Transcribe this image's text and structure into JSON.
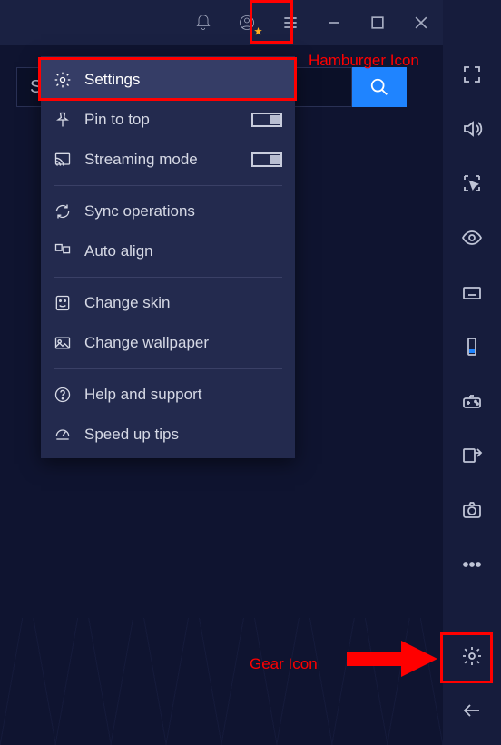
{
  "titlebar": {
    "icons": [
      "bell",
      "user",
      "hamburger",
      "minimize",
      "maximize",
      "close"
    ]
  },
  "search": {
    "value": "S"
  },
  "menu": {
    "items": [
      {
        "icon": "gear",
        "label": "Settings",
        "selected": true
      },
      {
        "icon": "pin",
        "label": "Pin to top",
        "toggle": "off"
      },
      {
        "icon": "cast",
        "label": "Streaming mode",
        "toggle": "off"
      },
      {
        "sep": true
      },
      {
        "icon": "sync",
        "label": "Sync operations"
      },
      {
        "icon": "align",
        "label": "Auto align"
      },
      {
        "sep": true
      },
      {
        "icon": "skin",
        "label": "Change skin"
      },
      {
        "icon": "image",
        "label": "Change wallpaper"
      },
      {
        "sep": true
      },
      {
        "icon": "help",
        "label": "Help and support"
      },
      {
        "icon": "speed",
        "label": "Speed up tips"
      }
    ]
  },
  "sidebar": {
    "items": [
      "fullscreen",
      "volume",
      "cursor-select",
      "eye",
      "keyboard",
      "phone",
      "gamepad",
      "location-share",
      "camera",
      "more"
    ],
    "bottom": [
      "gear",
      "back"
    ]
  },
  "annotations": {
    "hamburger": "Hamburger Icon",
    "gear": "Gear Icon"
  }
}
